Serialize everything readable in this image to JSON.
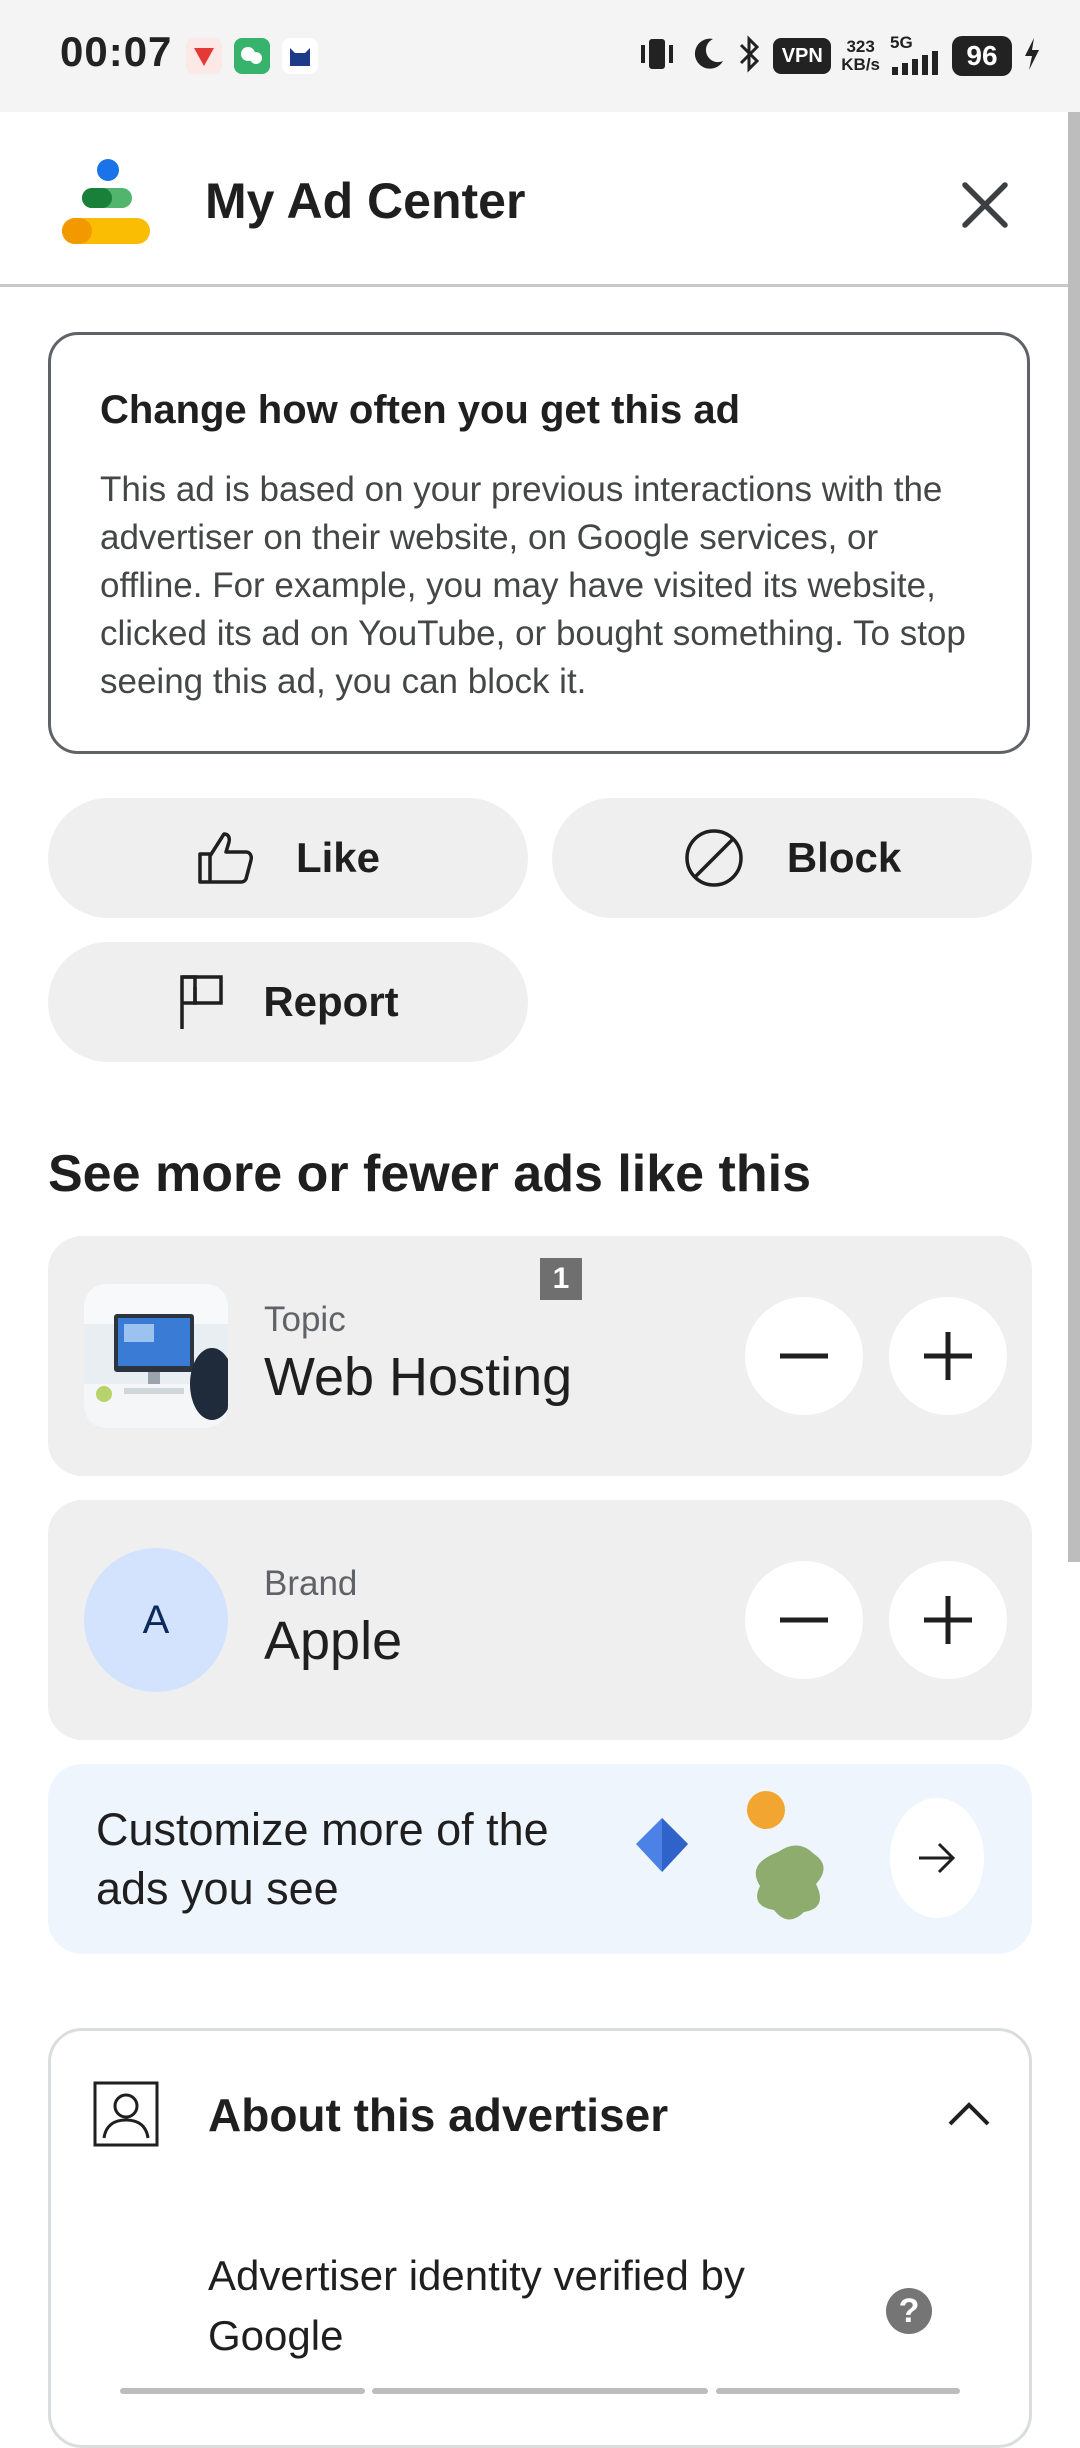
{
  "status_bar": {
    "time": "00:07",
    "vpn": "VPN",
    "speed_value": "323",
    "speed_unit": "KB/s",
    "network": "5G",
    "battery": "96"
  },
  "header": {
    "title": "My Ad Center"
  },
  "info_card": {
    "title": "Change how often you get this ad",
    "body": "This ad is based on your previous interactions with the advertiser on their website, on Google services, or offline. For example, you may have visited its website, clicked its ad on YouTube, or bought something. To stop seeing this ad, you can block it."
  },
  "actions": {
    "like": "Like",
    "block": "Block",
    "report": "Report"
  },
  "section_title": "See more or fewer ads like this",
  "topic": {
    "label": "Topic",
    "value": "Web Hosting",
    "badge": "1"
  },
  "brand": {
    "label": "Brand",
    "value": "Apple",
    "avatar_letter": "A"
  },
  "customize": {
    "text": "Customize more of the ads you see"
  },
  "about": {
    "title": "About this advertiser",
    "verified": "Advertiser identity verified by Google",
    "help": "?"
  },
  "colors": {
    "pill_bg": "#efefef",
    "customize_bg": "#eef5fd",
    "brand_avatar_bg": "#d3e3fd",
    "logo_blue": "#1a73e8",
    "logo_green": "#34a853",
    "logo_yellow": "#fbbc04",
    "logo_orange": "#f29900"
  }
}
